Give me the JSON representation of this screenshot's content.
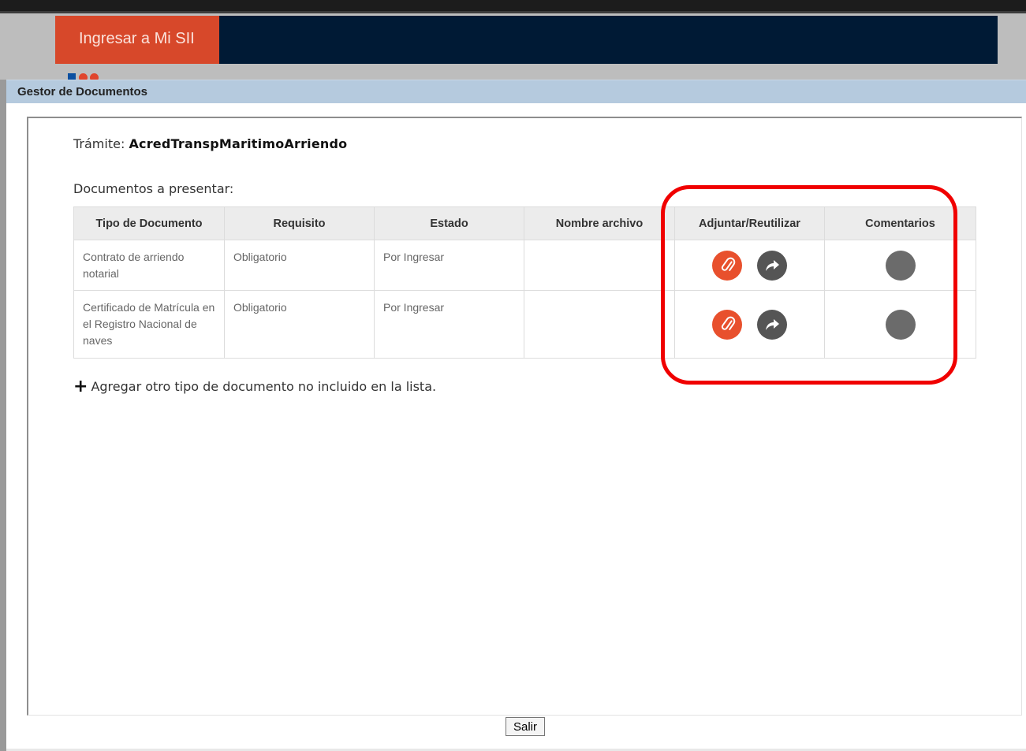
{
  "header": {
    "login_label": "Ingresar a Mi SII"
  },
  "window": {
    "title": "Gestor de Documentos"
  },
  "tramite": {
    "prefix": "Trámite:",
    "name": "AcredTranspMaritimoArriendo"
  },
  "documents": {
    "heading": "Documentos a presentar:",
    "columns": [
      "Tipo de Documento",
      "Requisito",
      "Estado",
      "Nombre archivo",
      "Adjuntar/Reutilizar",
      "Comentarios"
    ],
    "rows": [
      {
        "tipo": "Contrato de arriendo notarial",
        "requisito": "Obligatorio",
        "estado": "Por Ingresar",
        "nombre_archivo": ""
      },
      {
        "tipo": "Certificado de Matrícula en el Registro Nacional de naves",
        "requisito": "Obligatorio",
        "estado": "Por Ingresar",
        "nombre_archivo": ""
      }
    ],
    "add_label": "Agregar otro tipo de documento no incluido en la lista."
  },
  "footer": {
    "exit_label": "Salir"
  },
  "icons": {
    "attach": "paperclip-icon",
    "reuse": "share-arrow-icon",
    "comment": "comment-icon",
    "add": "plus-icon"
  },
  "colors": {
    "navbar": "#001a35",
    "login_button": "#d7482a",
    "title_bar": "#b5cade",
    "attach_icon": "#e8502d",
    "reuse_icon": "#555555",
    "comment_icon": "#6b6b6b",
    "highlight": "#f00000"
  }
}
